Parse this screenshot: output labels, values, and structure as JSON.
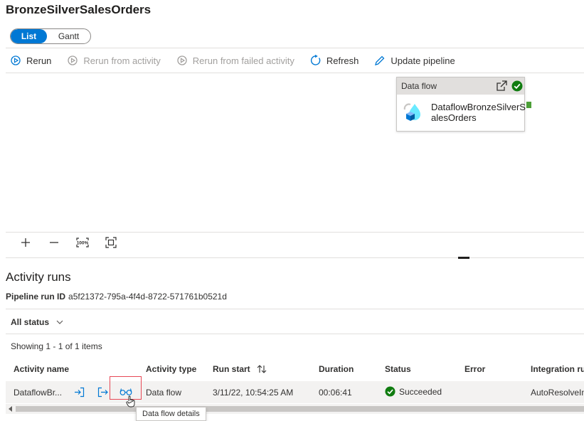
{
  "page": {
    "title": "BronzeSilverSalesOrders"
  },
  "view_toggle": {
    "list": "List",
    "gantt": "Gantt",
    "selected": "List"
  },
  "toolbar": {
    "rerun": "Rerun",
    "rerun_from_activity": "Rerun from activity",
    "rerun_from_failed": "Rerun from failed activity",
    "refresh": "Refresh",
    "update_pipeline": "Update pipeline"
  },
  "canvas": {
    "node": {
      "type": "Data flow",
      "name_line1": "DataflowBronzeSilverS",
      "name_line2": "alesOrders",
      "status": "succeeded"
    },
    "zoom": {
      "zoom_in": "+",
      "zoom_out": "—",
      "reset": "100%"
    }
  },
  "activity_runs": {
    "heading": "Activity runs",
    "pipeline_run_label": "Pipeline run ID",
    "pipeline_run_id": "a5f21372-795a-4f4d-8722-571761b0521d",
    "status_filter": "All status",
    "showing": "Showing 1 - 1 of 1 items",
    "columns": {
      "activity_name": "Activity name",
      "activity_type": "Activity type",
      "run_start": "Run start",
      "duration": "Duration",
      "status": "Status",
      "error": "Error",
      "integration_runtime": "Integration ru"
    },
    "rows": [
      {
        "activity_name": "DataflowBr...",
        "activity_type": "Data flow",
        "run_start": "3/11/22, 10:54:25 AM",
        "duration": "00:06:41",
        "status": "Succeeded",
        "error": "",
        "integration_runtime": "AutoResolveIn"
      }
    ],
    "tooltip": "Data flow details"
  },
  "colors": {
    "accent": "#0078d4",
    "success": "#107c10",
    "highlight": "#e74856"
  }
}
